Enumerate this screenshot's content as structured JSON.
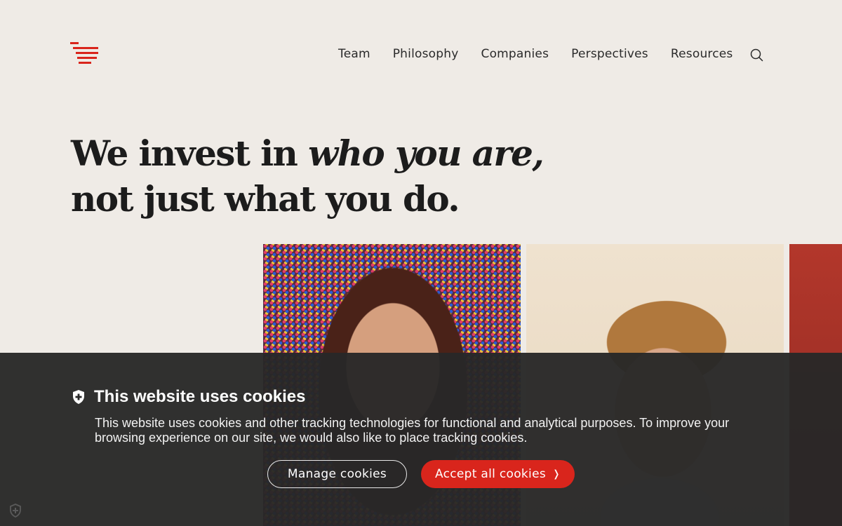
{
  "brand": {
    "accent": "#d9251c",
    "logo_icon": "stacked-lines-logo"
  },
  "nav": {
    "items": [
      {
        "label": "Team"
      },
      {
        "label": "Philosophy"
      },
      {
        "label": "Companies"
      },
      {
        "label": "Perspectives"
      },
      {
        "label": "Resources"
      }
    ],
    "search_icon": "search-icon"
  },
  "hero": {
    "line1_start": "We invest in ",
    "line1_italic": "who you are,",
    "line2": "not just what you do."
  },
  "cookie_banner": {
    "icon": "shield-icon",
    "title": "This website uses cookies",
    "body": "This website uses cookies and other tracking technologies for functional and analytical purposes. To improve your browsing experience on our site, we would also like to place tracking cookies.",
    "manage_label": "Manage cookies",
    "accept_label": "Accept all cookies",
    "accept_chevron": "❭",
    "corner_icon": "cookie-settings-shield-icon"
  },
  "colors": {
    "background": "#efebe6",
    "banner": "#282828",
    "text": "#1c1c1c"
  }
}
